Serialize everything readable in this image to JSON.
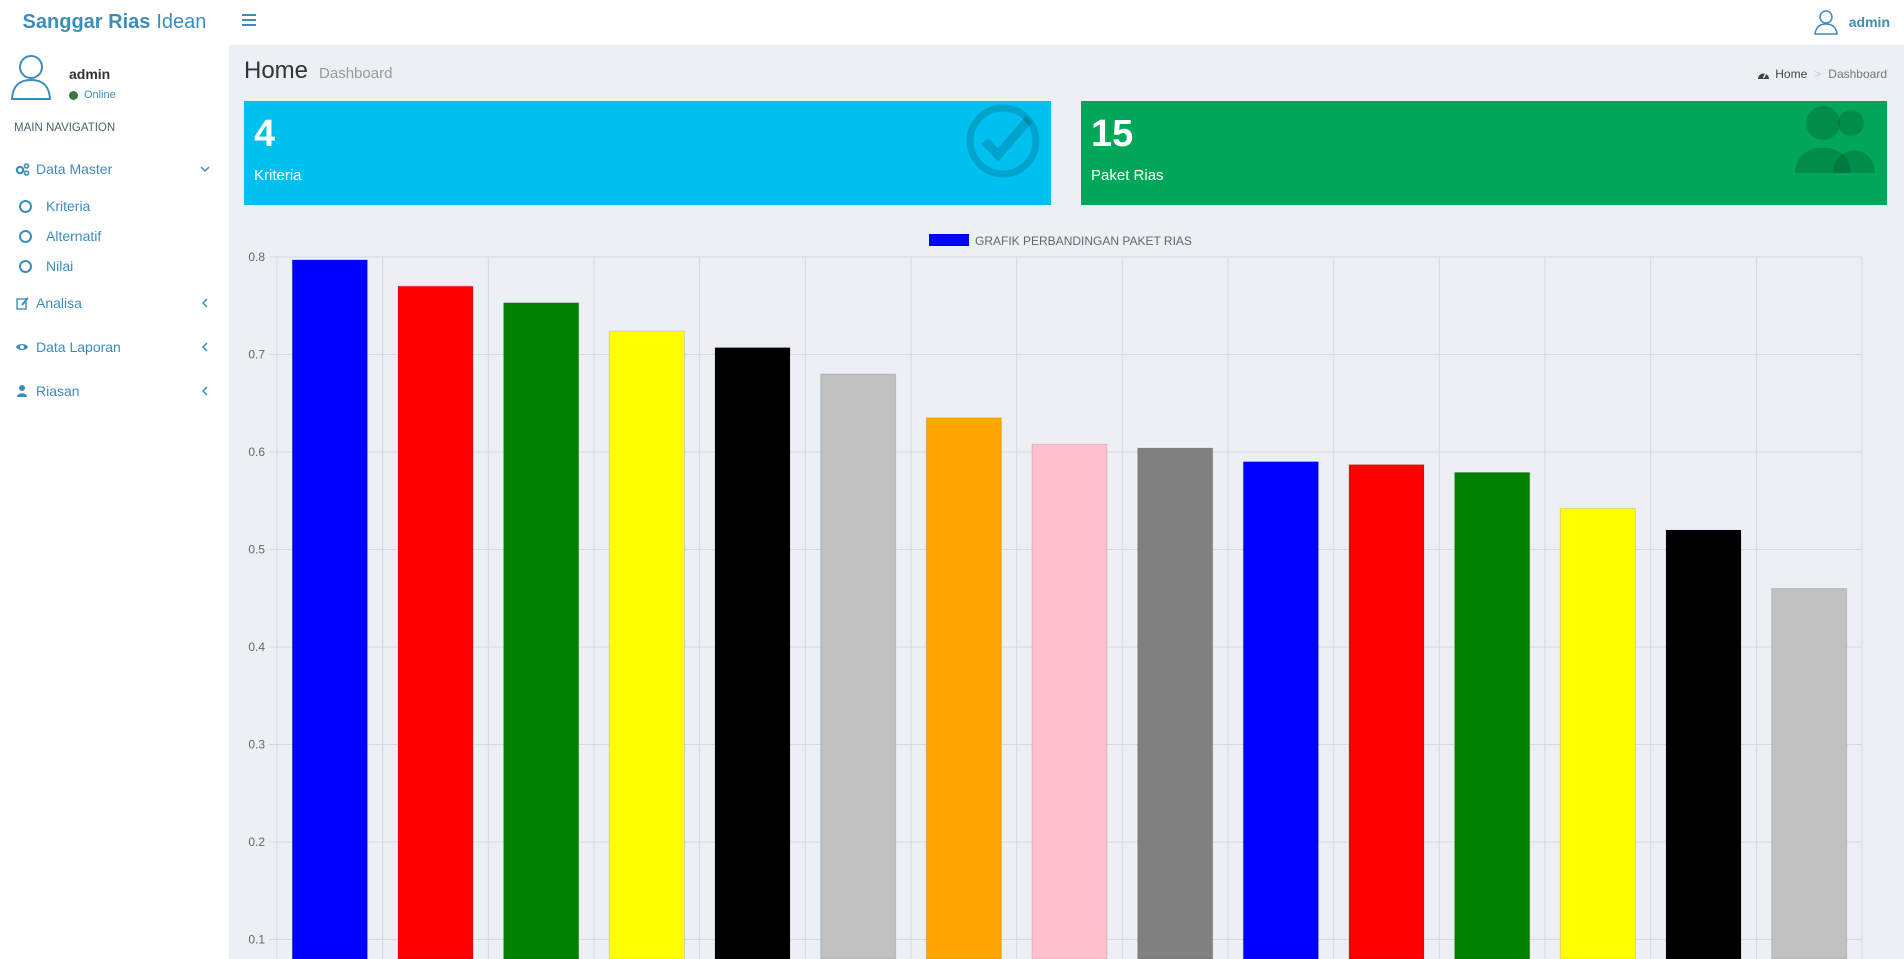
{
  "app": {
    "brand_bold": "Sanggar Rias",
    "brand_light": "Idean"
  },
  "topbar": {
    "user_name": "admin"
  },
  "sidebar": {
    "user": {
      "name": "admin",
      "status": "Online"
    },
    "nav_header": "MAIN NAVIGATION",
    "items": [
      {
        "label": "Data Master",
        "icon": "cogs-icon",
        "expanded": true,
        "children": [
          {
            "label": "Kriteria"
          },
          {
            "label": "Alternatif"
          },
          {
            "label": "Nilai"
          }
        ]
      },
      {
        "label": "Analisa",
        "icon": "edit-icon",
        "expanded": false
      },
      {
        "label": "Data Laporan",
        "icon": "eye-icon",
        "expanded": false
      },
      {
        "label": "Riasan",
        "icon": "user-icon",
        "expanded": false
      }
    ]
  },
  "header": {
    "title": "Home",
    "subtitle": "Dashboard"
  },
  "breadcrumb": {
    "home": "Home",
    "current": "Dashboard"
  },
  "stats": [
    {
      "value": "4",
      "label": "Kriteria",
      "color": "#00c0ef",
      "icon": "check-circle-icon"
    },
    {
      "value": "15",
      "label": "Paket Rias",
      "color": "#00a65a",
      "icon": "users-icon"
    }
  ],
  "chart_data": {
    "type": "bar",
    "legend": "GRAFIK PERBANDINGAN PAKET RIAS",
    "legend_color": "#0000ff",
    "legend_position": "top-center",
    "grid": true,
    "ylim": [
      0.08,
      0.8
    ],
    "yticks": [
      0.8,
      0.7,
      0.6,
      0.5,
      0.4,
      0.3,
      0.2,
      0.1
    ],
    "ytick_labels": [
      "0.8",
      "0.7",
      "0.6",
      "0.5",
      "0.4",
      "0.3",
      "0.2",
      "0.1"
    ],
    "values": [
      0.797,
      0.77,
      0.753,
      0.724,
      0.707,
      0.68,
      0.635,
      0.608,
      0.604,
      0.59,
      0.587,
      0.579,
      0.542,
      0.52,
      0.46
    ],
    "colors": [
      "#0000ff",
      "#ff0000",
      "#008000",
      "#ffff00",
      "#000000",
      "#c0c0c0",
      "#ffa500",
      "#ffc0cb",
      "#808080",
      "#0000ff",
      "#ff0000",
      "#008000",
      "#ffff00",
      "#000000",
      "#c0c0c0"
    ]
  }
}
